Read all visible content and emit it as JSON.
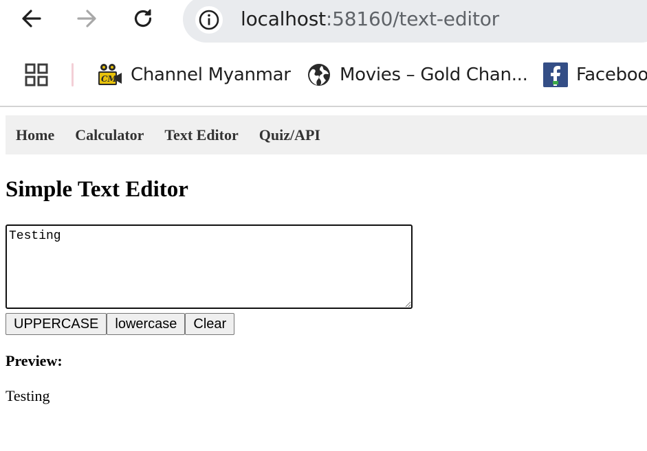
{
  "browser": {
    "url_host": "localhost",
    "url_rest": ":58160/text-editor",
    "bookmarks": [
      {
        "label": "Channel Myanmar",
        "icon": "movie-camera-icon"
      },
      {
        "label": "Movies – Gold Chan...",
        "icon": "globe-icon"
      },
      {
        "label": "Faceboo",
        "icon": "facebook-icon"
      }
    ]
  },
  "nav": {
    "items": [
      {
        "label": "Home"
      },
      {
        "label": "Calculator"
      },
      {
        "label": "Text Editor"
      },
      {
        "label": "Quiz/API"
      }
    ]
  },
  "editor": {
    "title": "Simple Text Editor",
    "textarea_value": "Testing",
    "buttons": {
      "uppercase": "UPPERCASE",
      "lowercase": "lowercase",
      "clear": "Clear"
    },
    "preview_label": "Preview:",
    "preview_text": "Testing"
  },
  "colors": {
    "nav_background": "#f0f0f0",
    "omnibox_background": "#e9ebee"
  }
}
